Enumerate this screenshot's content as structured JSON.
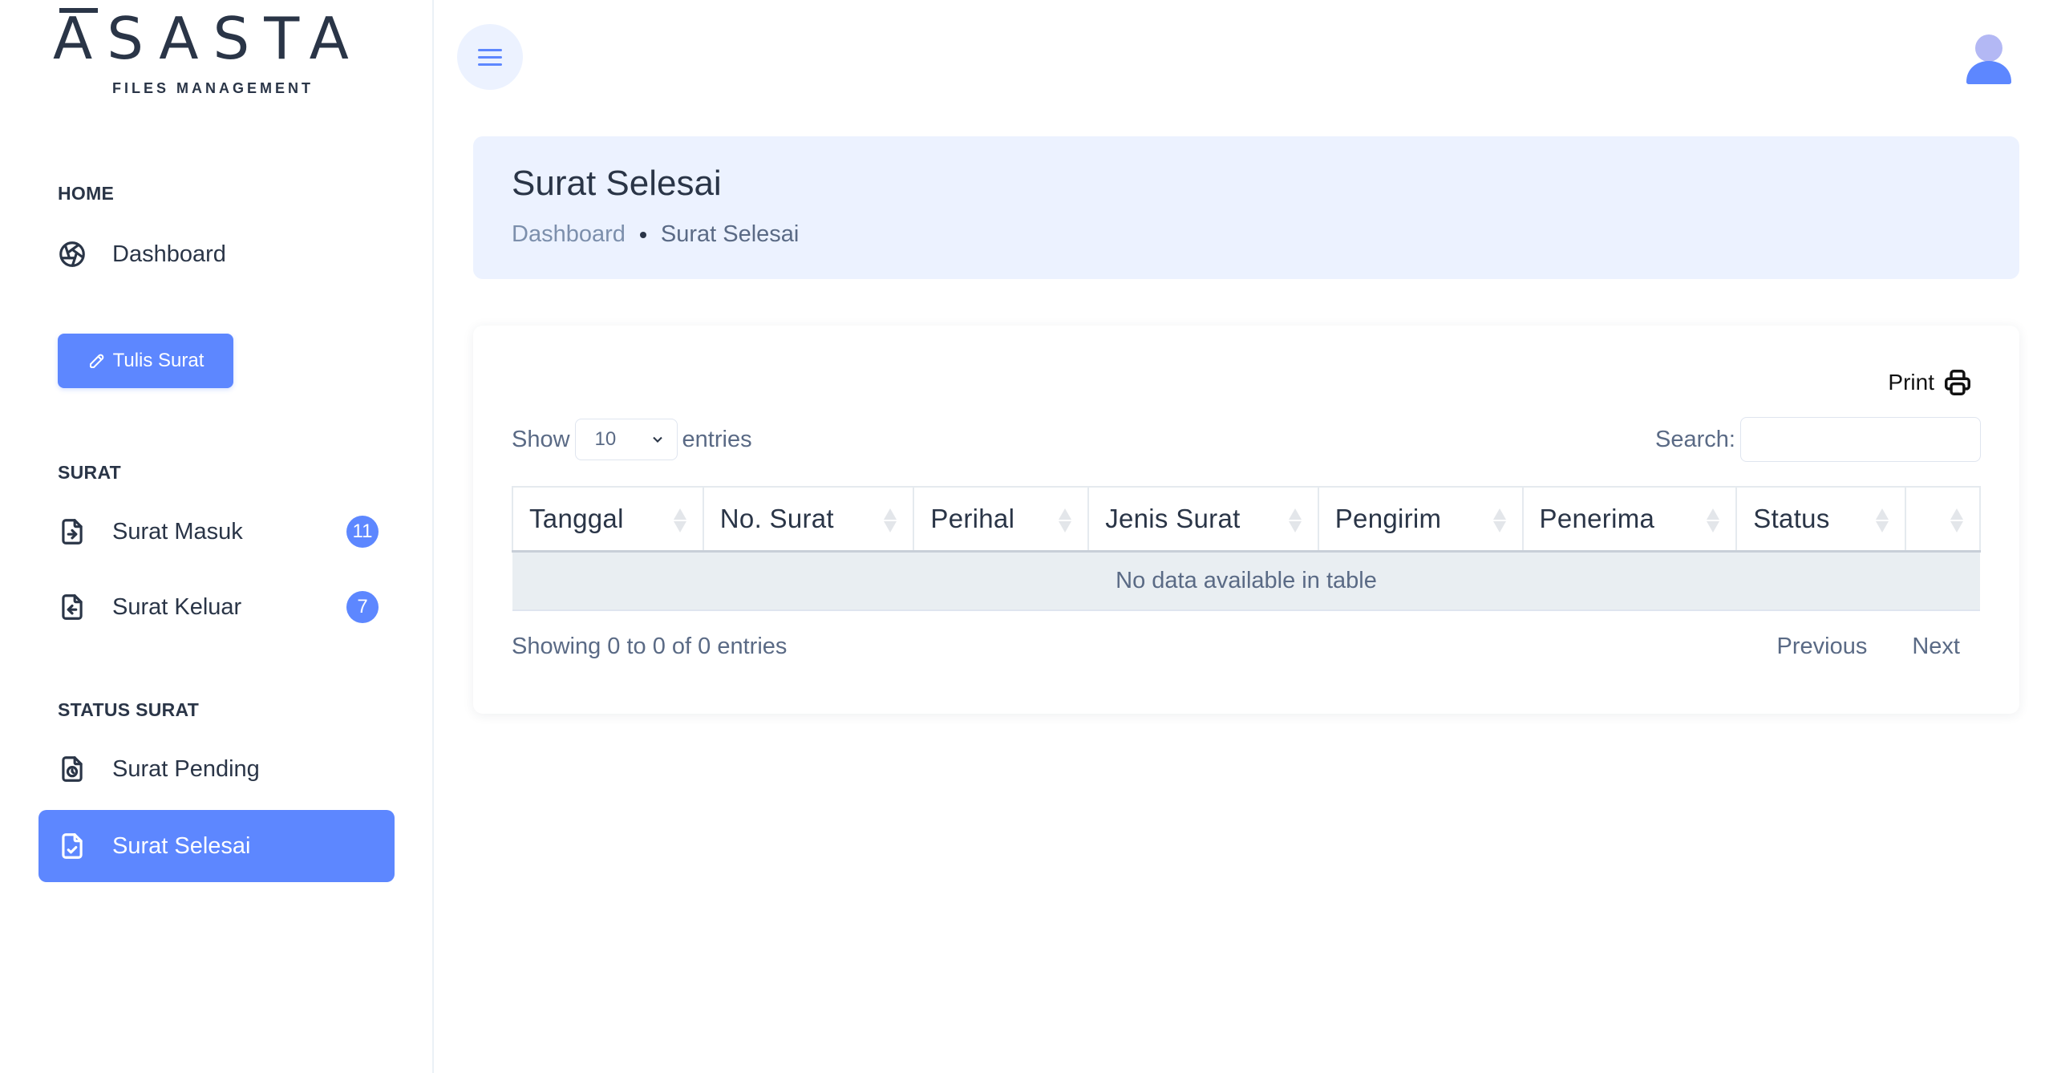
{
  "brand": {
    "name": "ASASTA",
    "tagline": "FILES MANAGEMENT"
  },
  "sidebar": {
    "home_caption": "HOME",
    "dashboard_label": "Dashboard",
    "write_button": "Tulis Surat",
    "surat_caption": "SURAT",
    "inbox_label": "Surat Masuk",
    "inbox_count": "11",
    "outbox_label": "Surat Keluar",
    "outbox_count": "7",
    "status_caption": "STATUS SURAT",
    "pending_label": "Surat Pending",
    "done_label": "Surat Selesai"
  },
  "page": {
    "title": "Surat Selesai",
    "breadcrumb": [
      "Dashboard",
      "Surat Selesai"
    ]
  },
  "table": {
    "print_label": "Print",
    "show_label": "Show",
    "page_size": "10",
    "entries_label": "entries",
    "search_label": "Search:",
    "columns": [
      "Tanggal",
      "No. Surat",
      "Perihal",
      "Jenis Surat",
      "Pengirim",
      "Penerima",
      "Status",
      ""
    ],
    "empty_message": "No data available in table",
    "info": "Showing 0 to 0 of 0 entries",
    "previous_label": "Previous",
    "next_label": "Next"
  },
  "colors": {
    "primary": "#5d87ff",
    "primary_light": "#ecf2ff",
    "text": "#2a3547",
    "muted": "#5a6a85"
  },
  "icons": [
    "aperture-icon",
    "pencil-icon",
    "file-import-icon",
    "file-export-icon",
    "file-pending-icon",
    "file-check-icon",
    "menu-icon",
    "user-avatar-icon",
    "printer-icon",
    "chevron-down-icon",
    "sort-icon"
  ]
}
